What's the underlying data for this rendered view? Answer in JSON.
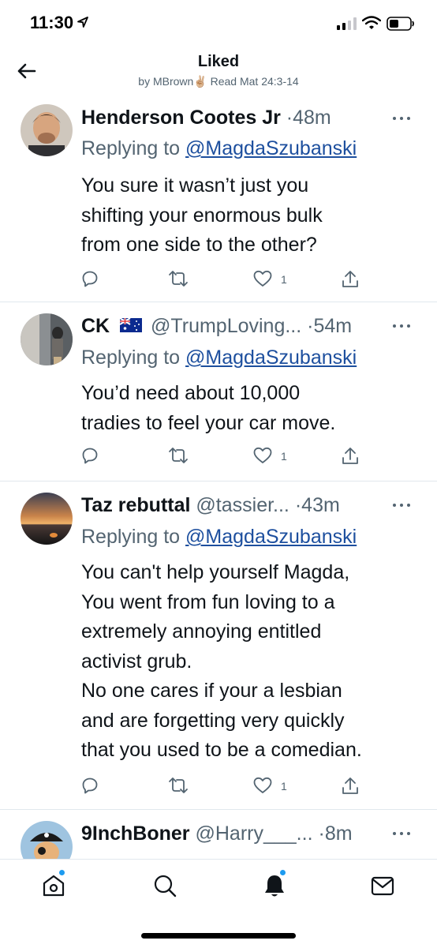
{
  "status_bar": {
    "time": "11:30"
  },
  "header": {
    "title": "Liked",
    "subtitle": "by MBrown✌🏼 Read Mat 24:3-14"
  },
  "tweets": [
    {
      "name": "Henderson Cootes Jr",
      "handle": "",
      "dot": "·",
      "time": "48m",
      "replying_prefix": "Replying to",
      "replying_handle": "@MagdaSzubanski",
      "text": "You sure it wasn’t just you\nshifting your enormous bulk\nfrom one side to the other?",
      "likes": "1"
    },
    {
      "name": "CK",
      "flag": "australia-flag",
      "handle": "@TrumpLoving...",
      "dot": "·",
      "time": "54m",
      "replying_prefix": "Replying to",
      "replying_handle": "@MagdaSzubanski",
      "text": "You’d need about 10,000\ntradies to feel your car move.",
      "likes": "1"
    },
    {
      "name": "Taz rebuttal",
      "handle": "@tassier...",
      "dot": "·",
      "time": "43m",
      "replying_prefix": "Replying to",
      "replying_handle": "@MagdaSzubanski",
      "text": "You can't help yourself Magda,\nYou went from fun loving to a\nextremely annoying entitled\nactivist grub.\nNo one cares if your a lesbian\nand are forgetting very quickly\nthat you used to be a comedian.",
      "likes": "1"
    },
    {
      "name": "9InchBoner",
      "handle": "@Harry___...",
      "dot": "·",
      "time": "8m"
    }
  ],
  "tab_bar": {
    "items": [
      "home-icon",
      "search-icon",
      "notifications-icon",
      "messages-icon"
    ]
  },
  "colors": {
    "link": "#1d4f9e",
    "secondary_text": "#536471",
    "notification_dot": "#1d9bf0"
  }
}
